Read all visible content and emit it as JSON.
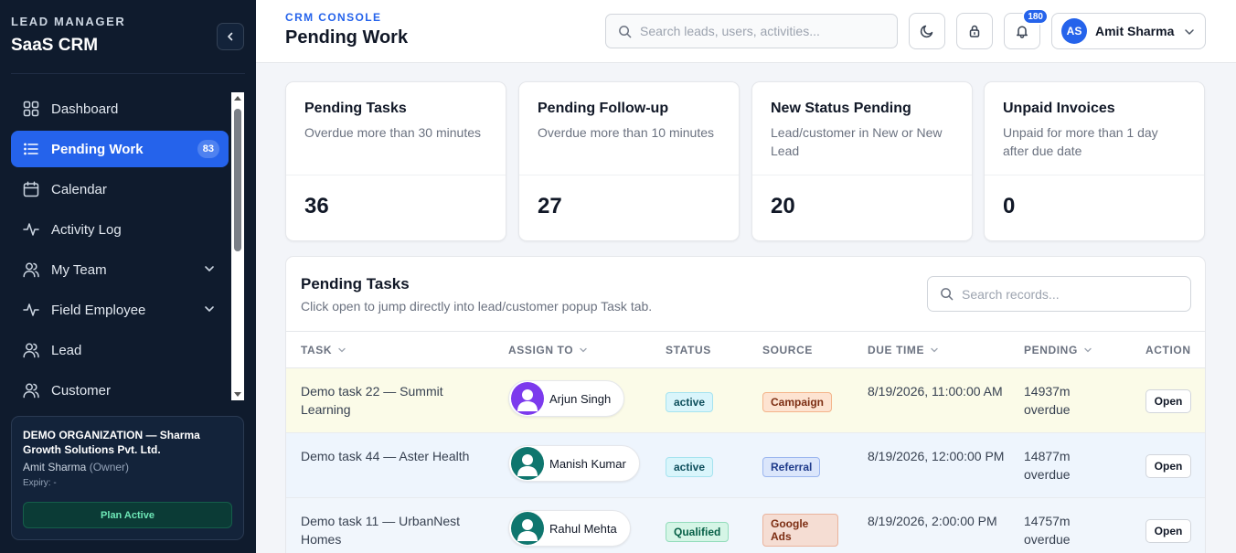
{
  "sidebar": {
    "eyebrow": "LEAD MANAGER",
    "app_name": "SaaS CRM",
    "items": [
      {
        "label": "Dashboard",
        "icon": "grid-icon"
      },
      {
        "label": "Pending Work",
        "icon": "list-icon",
        "badge": "83",
        "active": true
      },
      {
        "label": "Calendar",
        "icon": "calendar-icon"
      },
      {
        "label": "Activity Log",
        "icon": "activity-icon"
      },
      {
        "label": "My Team",
        "icon": "users-icon",
        "expandable": true
      },
      {
        "label": "Field Employee",
        "icon": "activity-icon",
        "expandable": true
      },
      {
        "label": "Lead",
        "icon": "users-icon"
      },
      {
        "label": "Customer",
        "icon": "users-icon"
      }
    ],
    "org": {
      "name": "DEMO ORGANIZATION — Sharma Growth Solutions Pvt. Ltd.",
      "user": "Amit Sharma",
      "role": "(Owner)",
      "expiry": "Expiry: -",
      "plan": "Plan Active"
    }
  },
  "header": {
    "eyebrow": "CRM CONSOLE",
    "title": "Pending Work",
    "search_placeholder": "Search leads, users, activities...",
    "notification_count": "180",
    "user_initials": "AS",
    "user_name": "Amit Sharma"
  },
  "stats": [
    {
      "title": "Pending Tasks",
      "subtitle": "Overdue more than 30 minutes",
      "value": "36"
    },
    {
      "title": "Pending Follow-up",
      "subtitle": "Overdue more than 10 minutes",
      "value": "27"
    },
    {
      "title": "New Status Pending",
      "subtitle": "Lead/customer in New or New Lead",
      "value": "20"
    },
    {
      "title": "Unpaid Invoices",
      "subtitle": "Unpaid for more than 1 day after due date",
      "value": "0"
    }
  ],
  "table": {
    "title": "Pending Tasks",
    "subtitle": "Click open to jump directly into lead/customer popup Task tab.",
    "search_placeholder": "Search records...",
    "columns": {
      "task": "TASK",
      "assign": "ASSIGN TO",
      "status": "STATUS",
      "source": "SOURCE",
      "due": "DUE TIME",
      "pending": "PENDING",
      "action": "ACTION"
    },
    "rows": [
      {
        "task": "Demo task 22 — Summit Learning",
        "assignee": "Arjun Singh",
        "status": "active",
        "source": "Campaign",
        "due": "8/19/2026, 11:00:00 AM",
        "pending": "14937m overdue",
        "action": "Open"
      },
      {
        "task": "Demo task 44 — Aster Health",
        "assignee": "Manish Kumar",
        "status": "active",
        "source": "Referral",
        "due": "8/19/2026, 12:00:00 PM",
        "pending": "14877m overdue",
        "action": "Open"
      },
      {
        "task": "Demo task 11 — UrbanNest Homes",
        "assignee": "Rahul Mehta",
        "status": "Qualified",
        "source": "Google Ads",
        "due": "8/19/2026, 2:00:00 PM",
        "pending": "14757m overdue",
        "action": "Open"
      }
    ]
  },
  "colors": {
    "accent": "#2563eb",
    "sidebar_bg": "#0f1b2d",
    "row1_bg": "#fbfbe8",
    "row2_bg": "#eef5fd",
    "row3_bg": "#f1f6fc",
    "avatar_purple": "#7c3aed",
    "avatar_green": "#0f766e"
  }
}
